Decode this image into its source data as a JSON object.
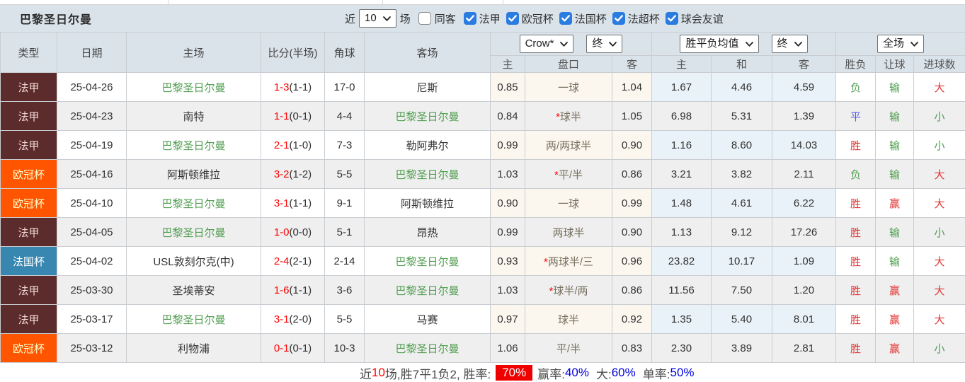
{
  "toolbar": {
    "title": "巴黎圣日尔曼",
    "recent_label": "近",
    "recent_value": "10",
    "matches_label": "场",
    "same_venue_label": "同客",
    "filters": [
      {
        "label": "法甲",
        "checked": true
      },
      {
        "label": "欧冠杯",
        "checked": true
      },
      {
        "label": "法国杯",
        "checked": true
      },
      {
        "label": "法超杯",
        "checked": true
      },
      {
        "label": "球会友谊",
        "checked": true
      }
    ]
  },
  "header": {
    "columns": {
      "type": "类型",
      "date": "日期",
      "home": "主场",
      "score": "比分(半场)",
      "corners": "角球",
      "away": "客场"
    },
    "odds_group": {
      "source": "Crow*",
      "state": "终",
      "sub": [
        "主",
        "盘口",
        "客"
      ]
    },
    "avg_group": {
      "source": "胜平负均值",
      "state": "终",
      "sub": [
        "主",
        "和",
        "客"
      ]
    },
    "result_group": {
      "scope": "全场",
      "sub": [
        "胜负",
        "让球",
        "进球数"
      ]
    }
  },
  "colors": {
    "ligue1_badge": "#5c2b2b",
    "ucl_badge": "#ff5500",
    "cdf_badge": "#3787b0",
    "team_highlight": "#4f9e4f",
    "score_red": "#ff0000",
    "win_red": "#e23333",
    "loss_green": "#4f9e4f",
    "draw_blue": "#5b5be0",
    "summary_highlight_bg": "#ee0000",
    "summary_value_blue": "#0000dd"
  },
  "rows": [
    {
      "type": "法甲",
      "type_key": "ligue1",
      "date": "25-04-26",
      "home": "巴黎圣日尔曼",
      "home_green": true,
      "score": "1-3",
      "half": "(1-1)",
      "corners": "17-0",
      "away": "尼斯",
      "away_green": false,
      "odds_home": "0.85",
      "handicap_star": false,
      "handicap": "一球",
      "odds_away": "1.04",
      "avg_home": "1.67",
      "avg_draw": "4.46",
      "avg_away": "4.59",
      "result": {
        "text": "负",
        "color": "green"
      },
      "handicap_result": {
        "text": "输",
        "color": "green"
      },
      "goals_result": {
        "text": "大",
        "color": "red"
      }
    },
    {
      "type": "法甲",
      "type_key": "ligue1",
      "date": "25-04-23",
      "home": "南特",
      "home_green": false,
      "score": "1-1",
      "half": "(0-1)",
      "corners": "4-4",
      "away": "巴黎圣日尔曼",
      "away_green": true,
      "odds_home": "0.84",
      "handicap_star": true,
      "handicap": "球半",
      "odds_away": "1.05",
      "avg_home": "6.98",
      "avg_draw": "5.31",
      "avg_away": "1.39",
      "result": {
        "text": "平",
        "color": "blue"
      },
      "handicap_result": {
        "text": "输",
        "color": "green"
      },
      "goals_result": {
        "text": "小",
        "color": "green"
      }
    },
    {
      "type": "法甲",
      "type_key": "ligue1",
      "date": "25-04-19",
      "home": "巴黎圣日尔曼",
      "home_green": true,
      "score": "2-1",
      "half": "(1-0)",
      "corners": "7-3",
      "away": "勒阿弗尔",
      "away_green": false,
      "odds_home": "0.99",
      "handicap_star": false,
      "handicap": "两/两球半",
      "odds_away": "0.90",
      "avg_home": "1.16",
      "avg_draw": "8.60",
      "avg_away": "14.03",
      "result": {
        "text": "胜",
        "color": "red"
      },
      "handicap_result": {
        "text": "输",
        "color": "green"
      },
      "goals_result": {
        "text": "小",
        "color": "green"
      }
    },
    {
      "type": "欧冠杯",
      "type_key": "ucl",
      "date": "25-04-16",
      "home": "阿斯顿维拉",
      "home_green": false,
      "score": "3-2",
      "half": "(1-2)",
      "corners": "5-5",
      "away": "巴黎圣日尔曼",
      "away_green": true,
      "odds_home": "1.03",
      "handicap_star": true,
      "handicap": "平/半",
      "odds_away": "0.86",
      "avg_home": "3.21",
      "avg_draw": "3.82",
      "avg_away": "2.11",
      "result": {
        "text": "负",
        "color": "green"
      },
      "handicap_result": {
        "text": "输",
        "color": "green"
      },
      "goals_result": {
        "text": "大",
        "color": "red"
      }
    },
    {
      "type": "欧冠杯",
      "type_key": "ucl",
      "date": "25-04-10",
      "home": "巴黎圣日尔曼",
      "home_green": true,
      "score": "3-1",
      "half": "(1-1)",
      "corners": "9-1",
      "away": "阿斯顿维拉",
      "away_green": false,
      "odds_home": "0.90",
      "handicap_star": false,
      "handicap": "一球",
      "odds_away": "0.99",
      "avg_home": "1.48",
      "avg_draw": "4.61",
      "avg_away": "6.22",
      "result": {
        "text": "胜",
        "color": "red"
      },
      "handicap_result": {
        "text": "赢",
        "color": "red"
      },
      "goals_result": {
        "text": "大",
        "color": "red"
      }
    },
    {
      "type": "法甲",
      "type_key": "ligue1",
      "date": "25-04-05",
      "home": "巴黎圣日尔曼",
      "home_green": true,
      "score": "1-0",
      "half": "(0-0)",
      "corners": "5-1",
      "away": "昂热",
      "away_green": false,
      "odds_home": "0.99",
      "handicap_star": false,
      "handicap": "两球半",
      "odds_away": "0.90",
      "avg_home": "1.13",
      "avg_draw": "9.12",
      "avg_away": "17.26",
      "result": {
        "text": "胜",
        "color": "red"
      },
      "handicap_result": {
        "text": "输",
        "color": "green"
      },
      "goals_result": {
        "text": "小",
        "color": "green"
      }
    },
    {
      "type": "法国杯",
      "type_key": "cdf",
      "date": "25-04-02",
      "home": "USL敦刻尔克(中)",
      "home_green": false,
      "score": "2-4",
      "half": "(2-1)",
      "corners": "2-14",
      "away": "巴黎圣日尔曼",
      "away_green": true,
      "odds_home": "0.93",
      "handicap_star": true,
      "handicap": "两球半/三",
      "odds_away": "0.96",
      "avg_home": "23.82",
      "avg_draw": "10.17",
      "avg_away": "1.09",
      "result": {
        "text": "胜",
        "color": "red"
      },
      "handicap_result": {
        "text": "输",
        "color": "green"
      },
      "goals_result": {
        "text": "大",
        "color": "red"
      }
    },
    {
      "type": "法甲",
      "type_key": "ligue1",
      "date": "25-03-30",
      "home": "圣埃蒂安",
      "home_green": false,
      "score": "1-6",
      "half": "(1-1)",
      "corners": "3-6",
      "away": "巴黎圣日尔曼",
      "away_green": true,
      "odds_home": "1.03",
      "handicap_star": true,
      "handicap": "球半/两",
      "odds_away": "0.86",
      "avg_home": "11.56",
      "avg_draw": "7.50",
      "avg_away": "1.20",
      "result": {
        "text": "胜",
        "color": "red"
      },
      "handicap_result": {
        "text": "赢",
        "color": "red"
      },
      "goals_result": {
        "text": "大",
        "color": "red"
      }
    },
    {
      "type": "法甲",
      "type_key": "ligue1",
      "date": "25-03-17",
      "home": "巴黎圣日尔曼",
      "home_green": true,
      "score": "3-1",
      "half": "(2-0)",
      "corners": "5-5",
      "away": "马赛",
      "away_green": false,
      "odds_home": "0.97",
      "handicap_star": false,
      "handicap": "球半",
      "odds_away": "0.92",
      "avg_home": "1.35",
      "avg_draw": "5.40",
      "avg_away": "8.01",
      "result": {
        "text": "胜",
        "color": "red"
      },
      "handicap_result": {
        "text": "赢",
        "color": "red"
      },
      "goals_result": {
        "text": "大",
        "color": "red"
      }
    },
    {
      "type": "欧冠杯",
      "type_key": "ucl",
      "date": "25-03-12",
      "home": "利物浦",
      "home_green": false,
      "score": "0-1",
      "half": "(0-1)",
      "corners": "10-3",
      "away": "巴黎圣日尔曼",
      "away_green": true,
      "odds_home": "1.06",
      "handicap_star": false,
      "handicap": "平/半",
      "odds_away": "0.83",
      "avg_home": "2.30",
      "avg_draw": "3.89",
      "avg_away": "2.81",
      "result": {
        "text": "胜",
        "color": "red"
      },
      "handicap_result": {
        "text": "赢",
        "color": "red"
      },
      "goals_result": {
        "text": "小",
        "color": "green"
      }
    }
  ],
  "summary": {
    "prefix": "近",
    "count": "10",
    "mid": "场,胜7平1负2, 胜率:",
    "win_rate": "70%",
    "handicap_label": "赢率:",
    "handicap_value": "40%",
    "goals_label": "大:",
    "goals_value": "60%",
    "single_label": "单率:",
    "single_value": "50%"
  }
}
